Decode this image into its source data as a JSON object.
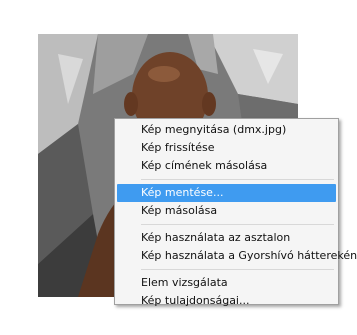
{
  "context_menu": {
    "items": [
      {
        "label": "Kép megnyitása (dmx.jpg)"
      },
      {
        "label": "Kép frissítése"
      },
      {
        "label": "Kép címének másolása"
      },
      {
        "label": "Kép mentése..."
      },
      {
        "label": "Kép másolása"
      },
      {
        "label": "Kép használata az asztalon"
      },
      {
        "label": "Kép használata a Gyorshívó háttereként"
      },
      {
        "label": "Elem vizsgálata"
      },
      {
        "label": "Kép tulajdonságai..."
      }
    ],
    "highlighted_item": "Kép mentése..."
  },
  "colors": {
    "highlight": "#3f9bf0",
    "menu_background": "#f5f5f5",
    "menu_border": "#a0a0a0"
  }
}
